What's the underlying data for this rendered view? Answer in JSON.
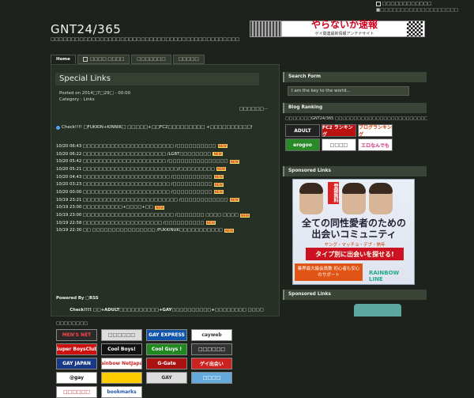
{
  "top": {
    "rss_label": "□□□□□□□□□□□□",
    "sub_label": "■□□□□□□□□□□□□□□□□□□□"
  },
  "site": {
    "title": "GNT24/365",
    "description": "□□□□□□□□□□□□□□□□□□□□□□□□□□□□□□□□□□□□□□□□□□□□□□"
  },
  "banner": {
    "title": "やらないか速報",
    "subtitle": "ゲイ関連最新情報アンテナサイト"
  },
  "nav": {
    "tabs": [
      "Home",
      "□□□□ □□□□",
      "□□□□□□□",
      "□□□□□"
    ]
  },
  "post": {
    "title": "Special Links",
    "posted": "Posted on 2014□7□29□ - 00:00",
    "category": "Category : Links",
    "more": "□□□□□□···",
    "check_line": "Check!!!! □FUKKIN+KINNIK□ □□□□□+□□FC2□□□□□□□□□ +□□□□□□□□□□!",
    "entries": [
      "10/20 06:43 □□□□□□□□□□□□□□□□□□□□□□□ /□□□□□□□□□□",
      "10/20 06:22 □□□□□□□□□□□□□□□□□□□□□ /LGBT□□□□□□□□",
      "10/20 05:42 □□□□□□□□□□□□□□□□□□□□□ /□□□□□□□□□□□□□□□",
      "10/20 05:21 □□□□□□□□□□□□□□□□□□□□□□□□/□□□□□□□□□",
      "10/20 04:43 □□□□□□□□□□□□□□□□□□□□□□ /□□□□□□□□□□",
      "10/20 03:23 □□□□□□□□□□□□□□□□□□□□□□ /□□□□□□□□□□",
      "10/20 00:00 □□□□□□□□□□□□□□□□□□□□□□ /□□□□□□□□□□",
      "10/19 23:21 □□□□□□□□□□□□□□□□□□□□□□□□ /□□□□□□□□□□□□",
      "10/19 23:00 □□□□□□□□□□+□□□□+□□",
      "10/19 23:00 □□□□□□□□□□□□□□□□□□□□□□□ /□□□□□□□ □□□□ □□□□",
      "10/19 22:58 □□□□□□□□□□□□□□□□□□□□ /□□□□□□□□□□",
      "10/19 22:30 □□ □□□□□□□□□□□□□□□□ /FUKKINUK□□□□□□□□□□□"
    ],
    "new_label": "NEW",
    "powered": "Powered By □RSS",
    "check2": "Check!!!! □□+ADULT□□□□□□□□□□+GAY□□□□□□□□□□+□□□□□□□□ □□□□",
    "links_label": "□□□□□□□□",
    "link_banners": [
      {
        "label": "MEN'S NET",
        "bg": "#2a2a2a",
        "fg": "#ff4444"
      },
      {
        "label": "□□□□□□",
        "bg": "#dddddd",
        "fg": "#333333"
      },
      {
        "label": "GAY EXPRESS",
        "bg": "#1155aa",
        "fg": "#ffffff"
      },
      {
        "label": "cayweb",
        "bg": "#ffffff",
        "fg": "#333333"
      },
      {
        "label": "Super BoysClub",
        "bg": "#cc1111",
        "fg": "#ffffff"
      },
      {
        "label": "Cool Boys!",
        "bg": "#111111",
        "fg": "#ffffff"
      },
      {
        "label": "Cool Guys !",
        "bg": "#228822",
        "fg": "#ffffff"
      },
      {
        "label": "□□□□□□",
        "bg": "#333333",
        "fg": "#ffffff"
      },
      {
        "label": "GAY JAPAN",
        "bg": "#1a3a88",
        "fg": "#ffffff"
      },
      {
        "label": "Rainbow NetJapan",
        "bg": "#ffffff",
        "fg": "#cc2222"
      },
      {
        "label": "G-Gate",
        "bg": "#aa1111",
        "fg": "#ffffff"
      },
      {
        "label": "ゲイ出会い",
        "bg": "#cc2222",
        "fg": "#ffffff"
      },
      {
        "label": "@gay",
        "bg": "#ffffff",
        "fg": "#111111"
      },
      {
        "label": "",
        "bg": "#ffcc00",
        "fg": "#333333"
      },
      {
        "label": "GAY",
        "bg": "#dddddd",
        "fg": "#333333"
      },
      {
        "label": "□□□□",
        "bg": "#66aadd",
        "fg": "#ffffff"
      },
      {
        "label": "□□□□□□",
        "bg": "#ffffff",
        "fg": "#cc2222"
      },
      {
        "label": "bookmarks",
        "bg": "#ffffff",
        "fg": "#2255aa"
      }
    ]
  },
  "sidebar": {
    "search_head": "Search Form",
    "search_placeholder": "I am the key to the world...",
    "ranking_head": "Blog Ranking",
    "ranking_text": "□□□□□□□GNT24/365 □□□□□□□□□□□□□□□□□□□□□□□□□□□□□□ □□□□□□□□□□□□",
    "ranking_buttons": [
      {
        "label": "ADULT",
        "bg": "#222222",
        "fg": "#ffffff"
      },
      {
        "label": "FC2 ランキング",
        "bg": "#bb1111",
        "fg": "#ffffff"
      },
      {
        "label": "ブログランキング",
        "bg": "#ffffff",
        "fg": "#cc3300"
      },
      {
        "label": "erogoo",
        "bg": "#2a8a2a",
        "fg": "#ffffff"
      },
      {
        "label": "□□□□",
        "bg": "#ffffff",
        "fg": "#333333"
      },
      {
        "label": "エロなんでも",
        "bg": "#ffffff",
        "fg": "#cc2277"
      }
    ],
    "sponsored_head": "Sponsored Links",
    "sponsored_head2": "Sponsored Links",
    "ad": {
      "free": "登録無料",
      "headline": "全ての同性愛者のための 出会いコミュニティ",
      "tagline": "ヤング・マッチョ・デブ・熟年",
      "band": "タイプ別に出会いを探せる!",
      "foot": "業界最大級会員数 初心者も安心のサポート",
      "brand": "RAINBOW LINE"
    }
  }
}
